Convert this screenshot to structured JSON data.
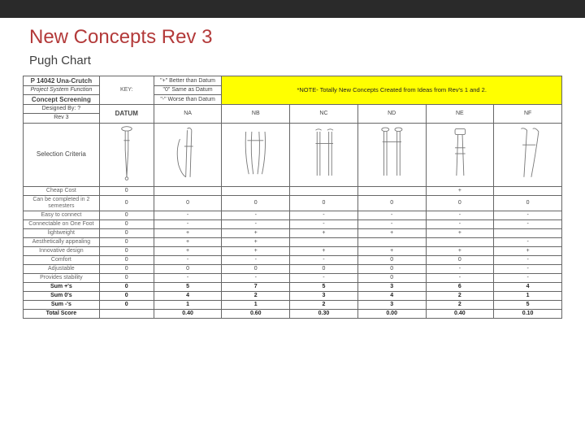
{
  "header": {
    "title": "New Concepts Rev 3",
    "subtitle": "Pugh Chart"
  },
  "meta": {
    "project": "P 14042 Una-Crutch",
    "system_func": "Project System Function",
    "screening": "Concept Screening",
    "designed_by": "Designed By: ?",
    "rev": "Rev 3",
    "key_label": "KEY:",
    "key_plus": "\"+\" Better than Datum",
    "key_zero": "\"0\" Same as Datum",
    "key_minus": "\"-\" Worse than Datum",
    "note": "*NOTE- Totally New Concepts Created from Ideas from Rev's 1 and 2.",
    "datum_label": "DATUM",
    "sel_crit": "Selection Criteria"
  },
  "concepts": [
    "NA",
    "NB",
    "NC",
    "ND",
    "NE",
    "NF"
  ],
  "criteria": [
    {
      "name": "Cheap Cost",
      "d": "0",
      "v": [
        "",
        "",
        "",
        "",
        "+",
        ""
      ]
    },
    {
      "name": "Can be completed in 2 semesters",
      "d": "0",
      "v": [
        "0",
        "0",
        "0",
        "0",
        "0",
        "0"
      ]
    },
    {
      "name": "Easy to connect",
      "d": "0",
      "v": [
        "-",
        "-",
        "-",
        "-",
        "-",
        "-"
      ]
    },
    {
      "name": "Connectable on One Foot",
      "d": "0",
      "v": [
        "-",
        "-",
        "-",
        "-",
        "-",
        "-"
      ]
    },
    {
      "name": "lightweight",
      "d": "0",
      "v": [
        "+",
        "+",
        "+",
        "+",
        "+",
        ""
      ]
    },
    {
      "name": "Aesthetically appealing",
      "d": "0",
      "v": [
        "+",
        "+",
        "",
        "",
        "",
        "-"
      ]
    },
    {
      "name": "Innovative design",
      "d": "0",
      "v": [
        "+",
        "+",
        "+",
        "+",
        "+",
        "+"
      ]
    },
    {
      "name": "Comfort",
      "d": "0",
      "v": [
        "-",
        "-",
        "-",
        "0",
        "0",
        "-"
      ]
    },
    {
      "name": "Adjustable",
      "d": "0",
      "v": [
        "0",
        "0",
        "0",
        "0",
        "-",
        "-"
      ]
    },
    {
      "name": "Provides stability",
      "d": "0",
      "v": [
        "-",
        "-",
        "-",
        "0",
        "-",
        "-"
      ]
    }
  ],
  "sums": {
    "plus": {
      "label": "Sum +'s",
      "d": "0",
      "v": [
        "5",
        "7",
        "5",
        "3",
        "6",
        "4"
      ]
    },
    "zero": {
      "label": "Sum 0's",
      "d": "0",
      "v": [
        "4",
        "2",
        "3",
        "4",
        "2",
        "1"
      ]
    },
    "minus": {
      "label": "Sum -'s",
      "d": "0",
      "v": [
        "1",
        "1",
        "2",
        "3",
        "2",
        "5"
      ]
    },
    "total": {
      "label": "Total Score",
      "d": "",
      "v": [
        "0.40",
        "0.60",
        "0.30",
        "0.00",
        "0.40",
        "0.10"
      ]
    }
  }
}
